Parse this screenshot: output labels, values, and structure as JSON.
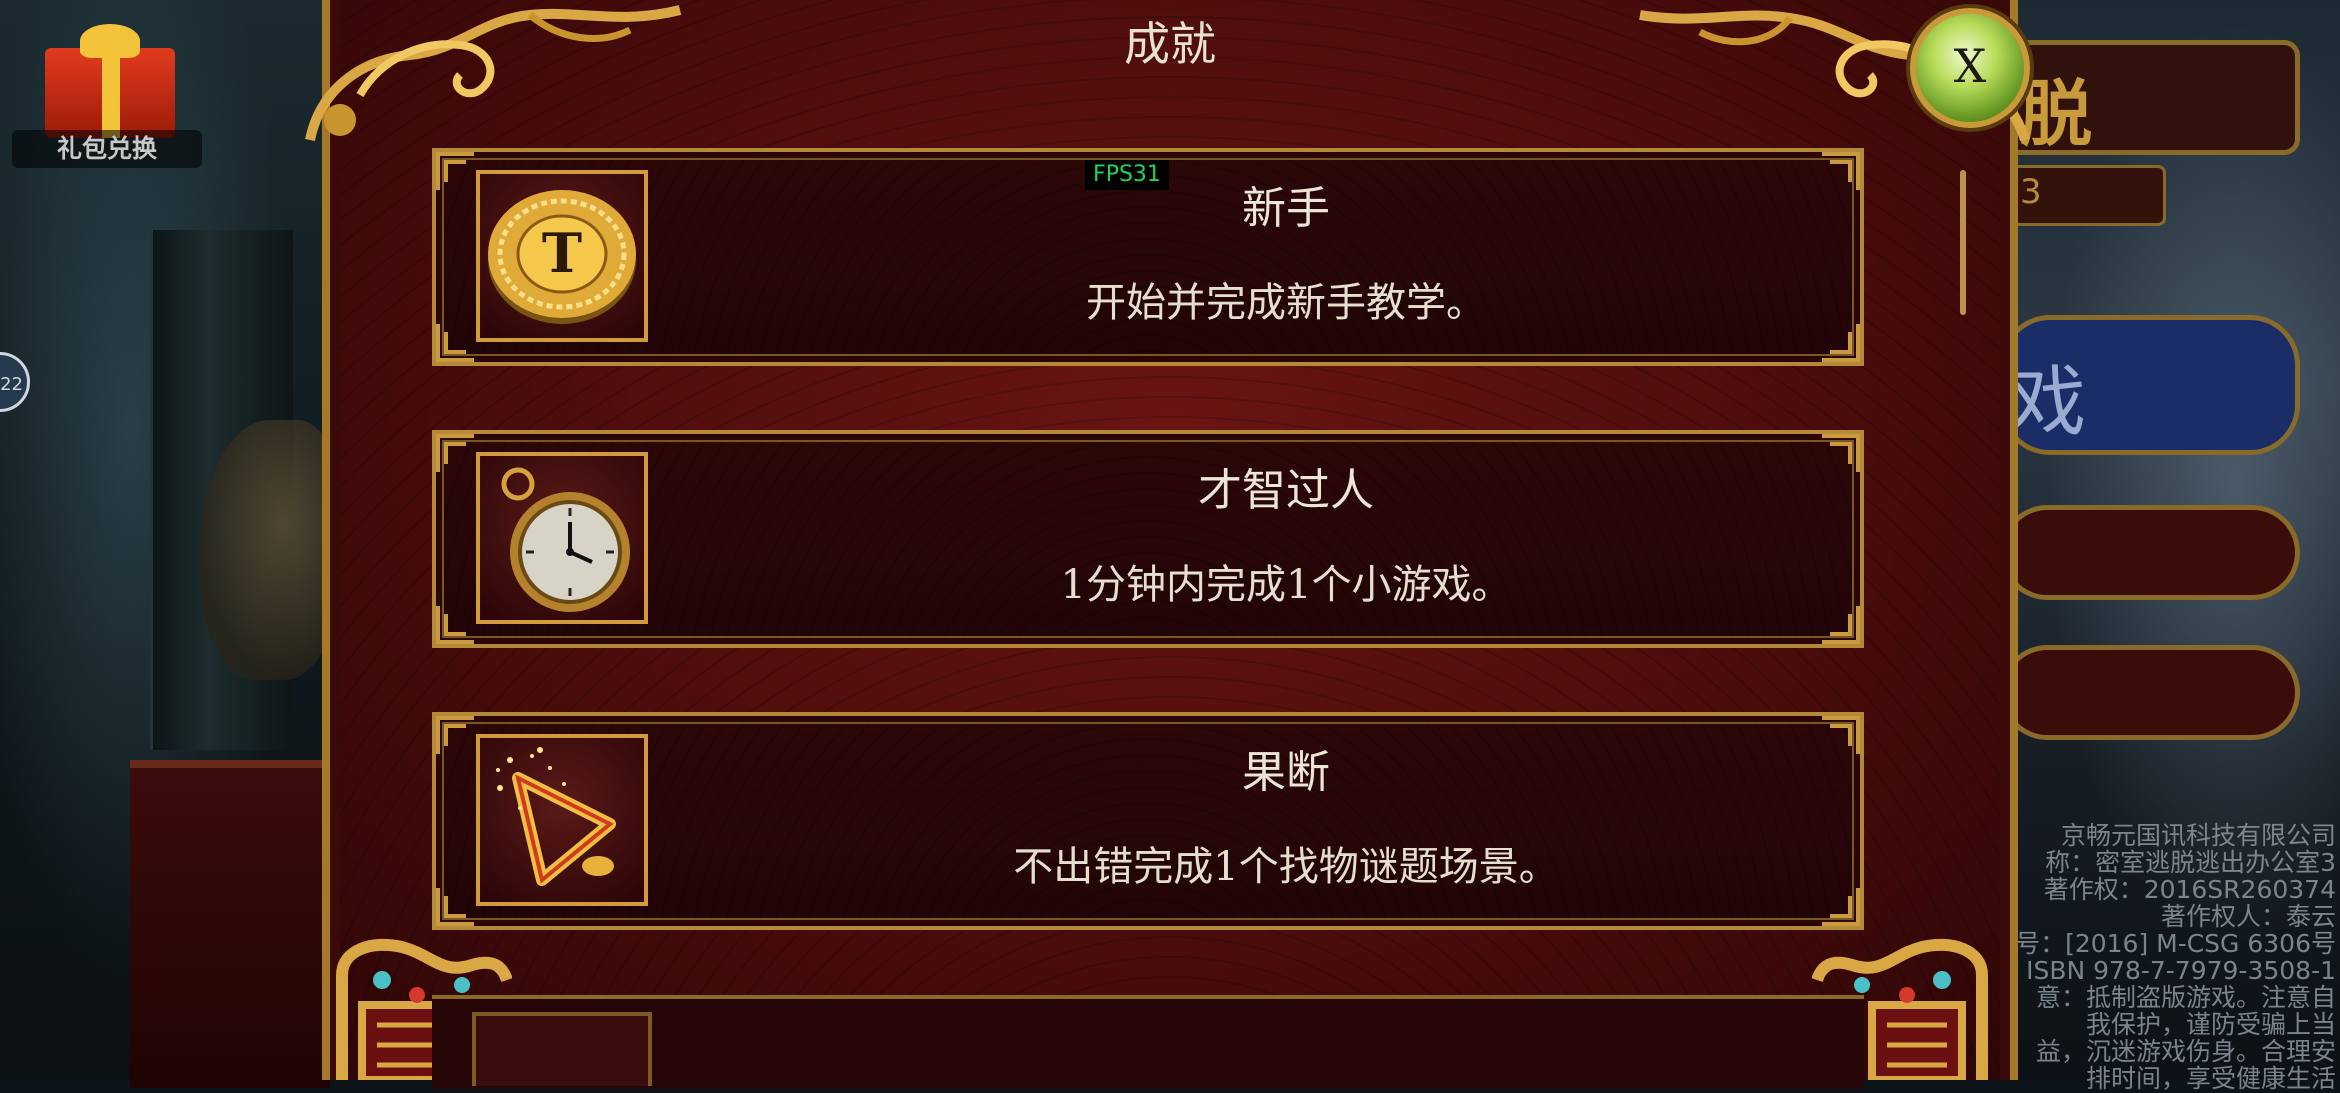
{
  "background": {
    "gift_label": "礼包兑换",
    "side_circle_text": "22",
    "right_title": "脱",
    "right_level": "3",
    "right_play": "戏",
    "credits": [
      "京畅元国讯科技有限公司",
      "称：密室逃脱逃出办公室3",
      "著作权：2016SR260374",
      "著作权人：泰云",
      "号：[2016] M-CSG 6306号",
      "ISBN 978-7-7979-3508-1",
      "意：抵制盗版游戏。注意自",
      "我保护，谨防受骗上当",
      "益，沉迷游戏伤身。合理安",
      "排时间，享受健康生活"
    ]
  },
  "dialog": {
    "title": "成就",
    "close_label": "X",
    "fps": "FPS31",
    "achievements": [
      {
        "title": "新手",
        "description": "开始并完成新手教学。",
        "icon": "t-coin-icon"
      },
      {
        "title": "才智过人",
        "description": "1分钟内完成1个小游戏。",
        "icon": "pocket-watch-icon"
      },
      {
        "title": "果断",
        "description": "不出错完成1个找物谜题场景。",
        "icon": "sparkle-triangle-icon"
      }
    ]
  },
  "colors": {
    "dialog_red": "#4a0c0b",
    "gold_border": "#b48a38",
    "close_green": "#b8dc5a",
    "fps_green": "#21d45a"
  }
}
